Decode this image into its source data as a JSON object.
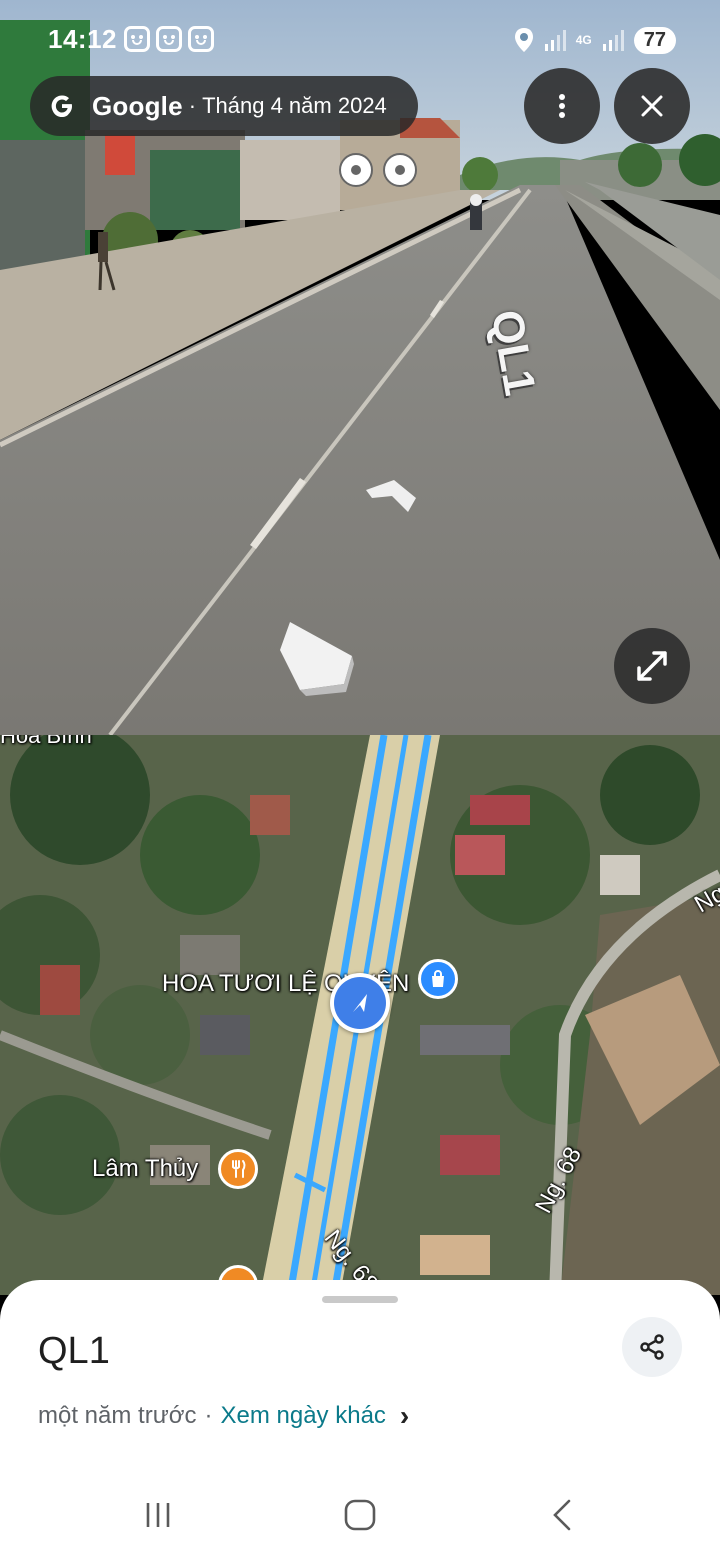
{
  "status_bar": {
    "time": "14:12",
    "network": "4G",
    "battery": "77",
    "icons": [
      "face-icon",
      "face-icon",
      "face-icon",
      "location-icon",
      "signal-icon",
      "signal-icon"
    ]
  },
  "street_view": {
    "brand": "Google",
    "separator": "·",
    "capture_date": "Tháng 4 năm 2024",
    "road_label": "QL1",
    "icons": [
      "google-g-icon",
      "more-vert-icon",
      "close-icon",
      "fullscreen-icon",
      "nav-arrow-icon"
    ]
  },
  "map": {
    "labels": {
      "top_left": "Hòa Bình",
      "poi_flower": "HOA TƯƠI LỆ QUYÊN",
      "poi_restaurant": "Lâm Thủy",
      "street_1": "Ng. 68",
      "street_2": "Ng. 68",
      "street_3": "Ng"
    },
    "icons": [
      "shopping-bag-icon",
      "restaurant-icon",
      "navigation-arrow-icon"
    ],
    "colors": {
      "route": "#3aa8ff",
      "restaurant": "#f08a24",
      "shopping": "#2b8cff",
      "location": "#3f7fe8"
    }
  },
  "sheet": {
    "title": "QL1",
    "relative_time": "một năm trước",
    "dot": "·",
    "other_dates_link": "Xem ngày khác",
    "chevron": "›"
  }
}
